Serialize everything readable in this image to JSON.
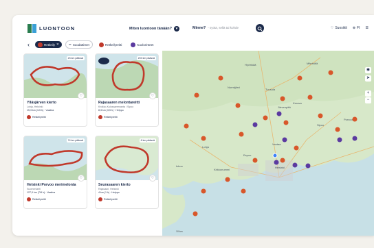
{
  "brand": {
    "name": "LUONTOON"
  },
  "header": {
    "question": "Miten luontoon tänään?",
    "search_label": "Minne?",
    "search_placeholder": "- syötä, sellä tai kohde",
    "links": [
      {
        "label": "Suosikit",
        "icon": "heart-icon"
      },
      {
        "label": "FI",
        "icon": "globe-icon"
      },
      {
        "label": "",
        "icon": "menu-icon"
      }
    ]
  },
  "filters": {
    "active_chip": "Retkeily",
    "filter_button": "Suodattimet",
    "chips": [
      {
        "label": "Retkeilyreitti",
        "color": "#c0392b"
      },
      {
        "label": "Kuolorinteet",
        "color": "#5b3aa0"
      }
    ]
  },
  "cards": [
    {
      "title": "Ylläsjärven kierto",
      "subtitle": "Lohja, Helsinki",
      "meta": "15,3 km (3-5 h) · Vaativa",
      "tag": "Retkeilyreitti",
      "distance": "23 km päässä"
    },
    {
      "title": "Rajasaaren melontareitti",
      "subtitle": "Kivikko-Kulosaarenranta / Sipoo",
      "meta": "8,3 km (3,5 h) · Helppo",
      "tag": "Retkeilyreitti",
      "distance": "203 km päässä"
    },
    {
      "title": "Helsinki Porvoo merimelonta",
      "subtitle": "Suomenlahti",
      "meta": "127,0 km (7/8 h) · Vaativa",
      "tag": "Retkeilyreitti",
      "distance": "74 km päässä"
    },
    {
      "title": "Seurasaaren kierto",
      "subtitle": "Rajasaari, Helsinki",
      "meta": "4 km (1 h) · Helppo",
      "tag": "Retkeilyreitti",
      "distance": "6 km päässä"
    }
  ],
  "map": {
    "labels": [
      "Hyvinkää",
      "Järvenpää",
      "Porvoo",
      "Vantaa",
      "Espoo",
      "Helsinki",
      "Lohja",
      "Kerava",
      "Mäntsälä",
      "Sipoo",
      "Nurmijärvi",
      "Tuusula",
      "Kirkkonummi",
      "Inkoo"
    ],
    "scale": "10 km"
  },
  "colors": {
    "navy": "#1b2a4a",
    "route_red": "#c0392b",
    "purple": "#5b3aa0",
    "orange_pin": "#d8572a"
  }
}
